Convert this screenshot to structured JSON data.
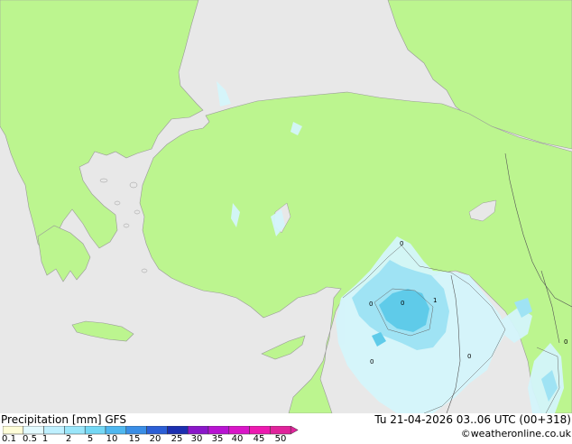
{
  "map": {
    "contour_values": [
      "0",
      "0",
      "1",
      "0",
      "0",
      "0",
      "0"
    ]
  },
  "footer": {
    "title": "Precipitation [mm]  GFS",
    "datetime": "Tu 21-04-2026 03..06 UTC (00+318)",
    "credit": "©weatheronline.co.uk"
  },
  "legend": {
    "ticks": [
      "0.1",
      "0.5",
      "1",
      "2",
      "5",
      "10",
      "15",
      "20",
      "25",
      "30",
      "35",
      "40",
      "45",
      "50"
    ],
    "colors": [
      "#fffed8",
      "#e2faff",
      "#bff0ff",
      "#9ae6fa",
      "#74d8f5",
      "#4fb8f0",
      "#3a8ee6",
      "#2c5fd6",
      "#1c2fb0",
      "#8a17c9",
      "#b814d2",
      "#d916c8",
      "#ed1ab0",
      "#e0239b"
    ]
  },
  "colors": {
    "land": "#bcf58f",
    "sea": "#e8e8e8",
    "light_precip": "#d4f5fb",
    "medium_precip": "#9fe3f4",
    "heavy_precip": "#5fcbe9",
    "coast": "#999999"
  }
}
